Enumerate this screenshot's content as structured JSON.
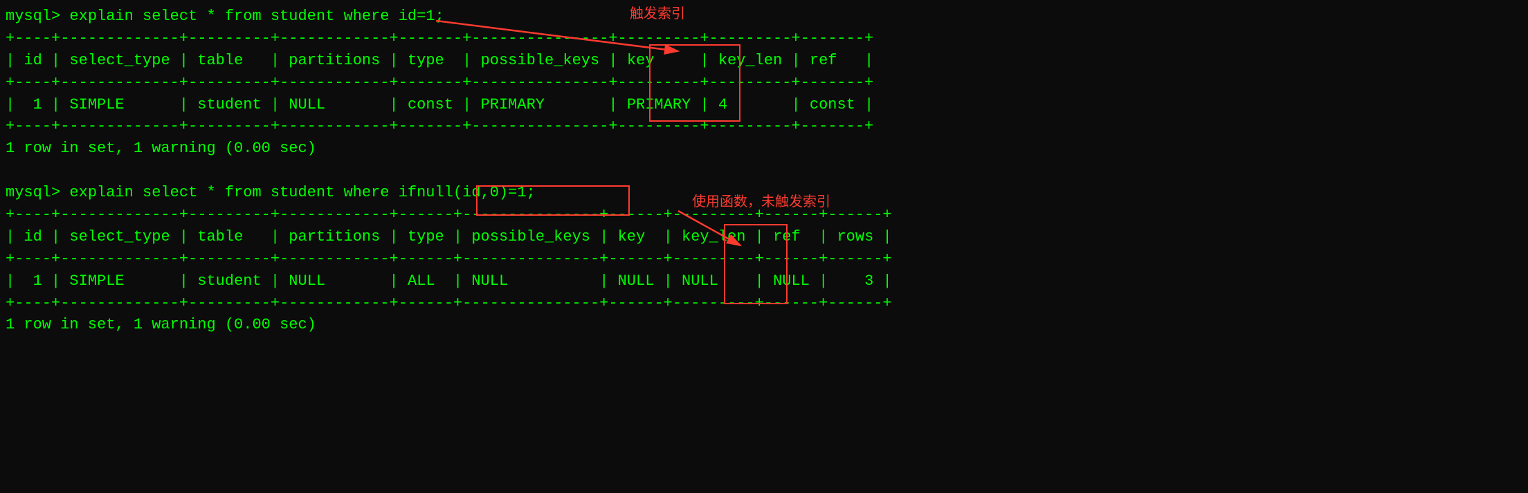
{
  "query1": {
    "prompt": "mysql> ",
    "sql": "explain select * from student where id=1;",
    "annotation": "触发索引",
    "columns": [
      "id",
      "select_type",
      "table",
      "partitions",
      "type",
      "possible_keys",
      "key",
      "key_len",
      "ref"
    ],
    "row": {
      "id": "1",
      "select_type": "SIMPLE",
      "table": "student",
      "partitions": "NULL",
      "type": "const",
      "possible_keys": "PRIMARY",
      "key": "PRIMARY",
      "key_len": "4",
      "ref": "const"
    },
    "footer": "1 row in set, 1 warning (0.00 sec)"
  },
  "query2": {
    "prompt": "mysql> ",
    "sql_before_box": "explain select * from student where ",
    "sql_in_box": "ifnull(id,0)=1;",
    "annotation": "使用函数，未触发索引",
    "columns": [
      "id",
      "select_type",
      "table",
      "partitions",
      "type",
      "possible_keys",
      "key",
      "key_len",
      "ref",
      "rows"
    ],
    "row": {
      "id": "1",
      "select_type": "SIMPLE",
      "table": "student",
      "partitions": "NULL",
      "type": "ALL",
      "possible_keys": "NULL",
      "key": "NULL",
      "key_len": "NULL",
      "ref": "NULL",
      "rows": "3"
    },
    "footer": "1 row in set, 1 warning (0.00 sec)"
  },
  "chart_data": {
    "type": "table",
    "tables": [
      {
        "title": "explain select * from student where id=1;",
        "columns": [
          "id",
          "select_type",
          "table",
          "partitions",
          "type",
          "possible_keys",
          "key",
          "key_len",
          "ref"
        ],
        "rows": [
          [
            "1",
            "SIMPLE",
            "student",
            "NULL",
            "const",
            "PRIMARY",
            "PRIMARY",
            "4",
            "const"
          ]
        ]
      },
      {
        "title": "explain select * from student where ifnull(id,0)=1;",
        "columns": [
          "id",
          "select_type",
          "table",
          "partitions",
          "type",
          "possible_keys",
          "key",
          "key_len",
          "ref",
          "rows"
        ],
        "rows": [
          [
            "1",
            "SIMPLE",
            "student",
            "NULL",
            "ALL",
            "NULL",
            "NULL",
            "NULL",
            "NULL",
            "3"
          ]
        ]
      }
    ]
  }
}
